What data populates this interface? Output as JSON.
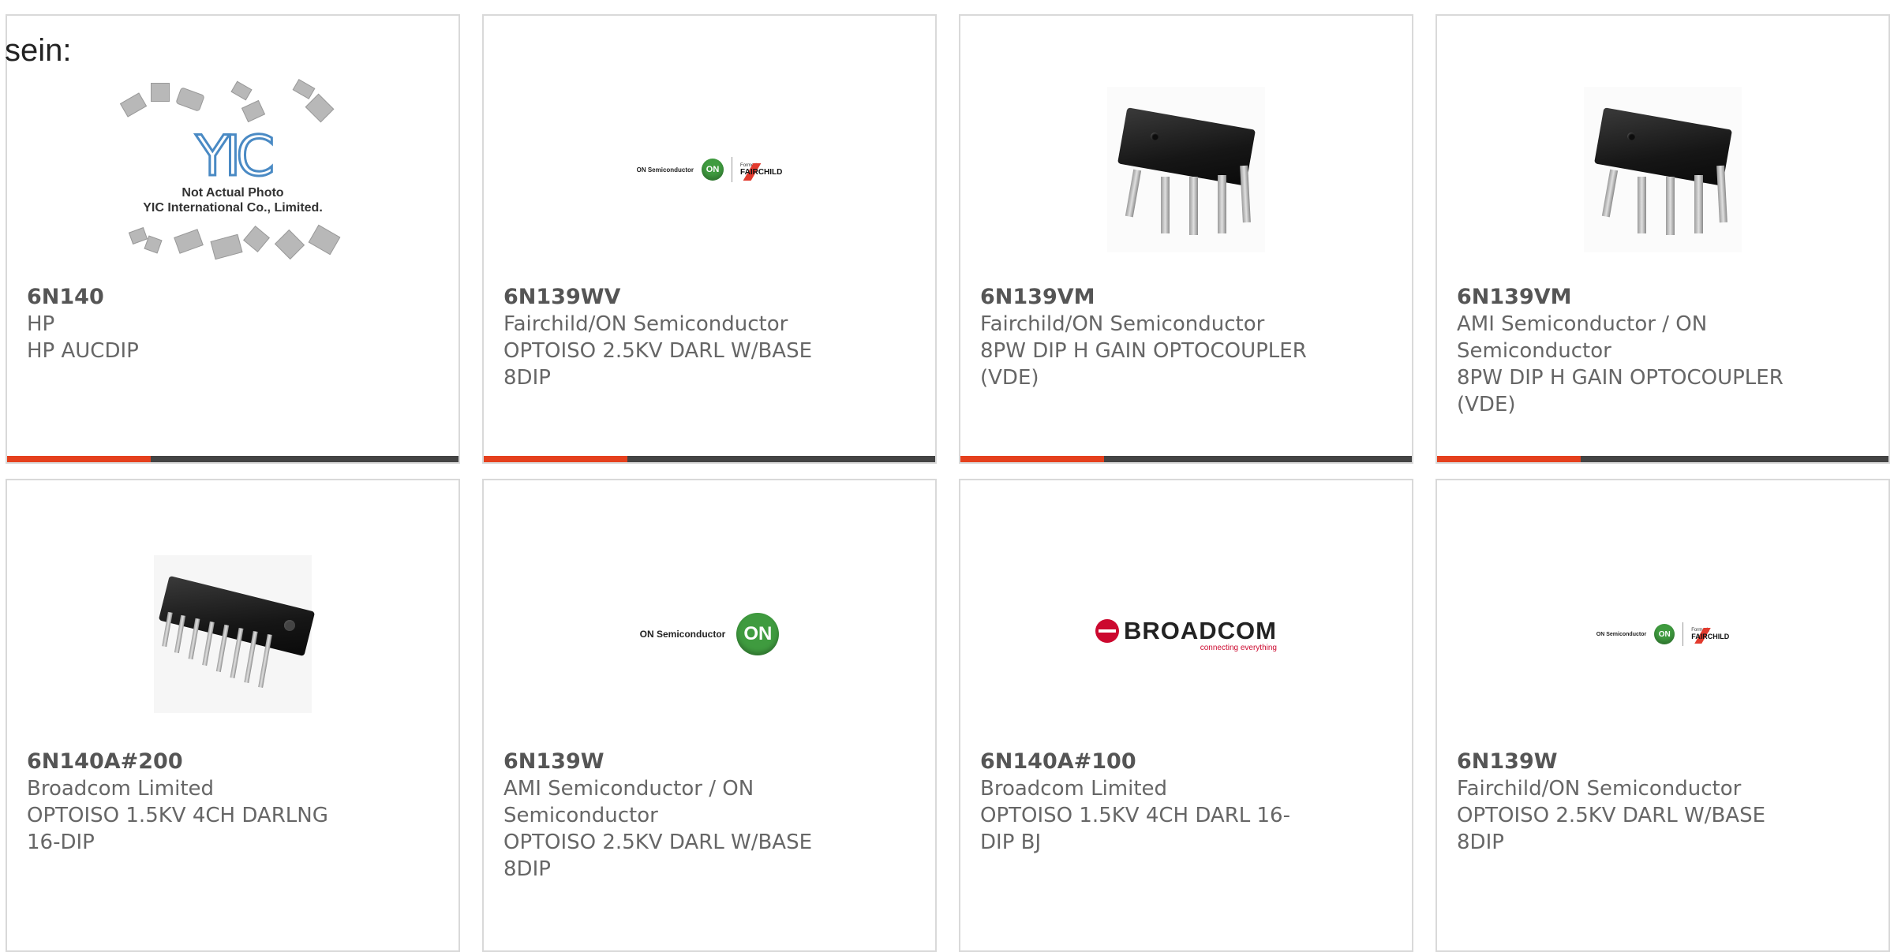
{
  "intro_text": "sein:",
  "colors": {
    "accent": "#e5401d",
    "bar": "#444444",
    "border": "#d9d9d9"
  },
  "cards": [
    {
      "part": "6N140",
      "manufacturer": "HP",
      "description": "HP AUCDIP",
      "image": "yic-placeholder",
      "image_text": {
        "logo": "YIC",
        "line1": "Not Actual Photo",
        "line2": "YIC International Co., Limited."
      }
    },
    {
      "part": "6N139WV",
      "manufacturer": "Fairchild/ON Semiconductor",
      "description": "OPTOISO 2.5KV DARL W/BASE 8DIP",
      "image": "onsemi-fairchild-logo",
      "image_text": {
        "on_semi": "ON Semiconductor",
        "on": "ON",
        "formerly": "Formerly",
        "fairchild": "FAIRCHILD"
      }
    },
    {
      "part": "6N139VM",
      "manufacturer": "Fairchild/ON Semiconductor",
      "description": "8PW DIP H GAIN OPTOCOUPLER (VDE)",
      "image": "dip8-chip"
    },
    {
      "part": "6N139VM",
      "manufacturer": "AMI Semiconductor / ON Semiconductor",
      "description": "8PW DIP H GAIN OPTOCOUPLER (VDE)",
      "image": "dip8-chip"
    },
    {
      "part": "6N140A#200",
      "manufacturer": "Broadcom Limited",
      "description": "OPTOISO 1.5KV 4CH DARLNG 16-DIP",
      "image": "dip16-chip"
    },
    {
      "part": "6N139W",
      "manufacturer": "AMI Semiconductor / ON Semiconductor",
      "description": "OPTOISO 2.5KV DARL W/BASE 8DIP",
      "image": "onsemi-logo",
      "image_text": {
        "on_semi": "ON Semiconductor",
        "on": "ON"
      }
    },
    {
      "part": "6N140A#100",
      "manufacturer": "Broadcom Limited",
      "description": "OPTOISO 1.5KV 4CH DARL 16-DIP BJ",
      "image": "broadcom-logo",
      "image_text": {
        "word": "BROADCOM",
        "tagline": "connecting everything"
      }
    },
    {
      "part": "6N139W",
      "manufacturer": "Fairchild/ON Semiconductor",
      "description": "OPTOISO 2.5KV DARL W/BASE 8DIP",
      "image": "onsemi-fairchild-logo",
      "image_text": {
        "on_semi": "ON Semiconductor",
        "on": "ON",
        "formerly": "Formerly",
        "fairchild": "FAIRCHILD"
      }
    }
  ]
}
